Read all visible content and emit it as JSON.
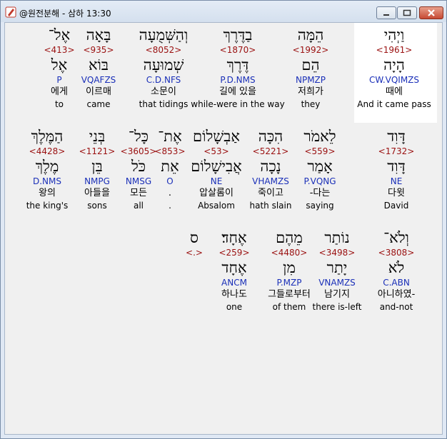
{
  "window": {
    "title": "@원전분해 - 삼하 13:30",
    "icon": "app-icon",
    "controls": [
      "minimize",
      "maximize",
      "close"
    ]
  },
  "rows": [
    [
      {
        "heb": "וַיְהִי",
        "num": "<1961>",
        "lemma": "הָיָה",
        "parse": "CW.VQIMZS",
        "kor": "때에",
        "eng": "And it came pass"
      },
      {
        "heb": "הֵמָּה",
        "num": "<1992>",
        "lemma": "הֵם",
        "parse": "NPMZP",
        "kor": "저희가",
        "eng": "they"
      },
      {
        "heb": "בַדֶּרֶךְ",
        "num": "<1870>",
        "lemma": "דֶּרֶךְ",
        "parse": "P.D.NMS",
        "kor": "길에 있을",
        "eng": "while-were in the way"
      },
      {
        "heb": "וְהַשְּׁמֻעָה",
        "num": "<8052>",
        "lemma": "שְׁמוּעָה",
        "parse": "C.D.NFS",
        "kor": "소문이",
        "eng": "that tidings"
      },
      {
        "heb": "בָּאָה",
        "num": "<935>",
        "lemma": "בּוֹא",
        "parse": "VQAFZS",
        "kor": "이르매",
        "eng": "came"
      },
      {
        "heb": "אֶל־",
        "num": "<413>",
        "lemma": "אֶל",
        "parse": "P",
        "kor": "에게",
        "eng": "to"
      }
    ],
    [
      {
        "heb": "דָּוִד",
        "num": "<1732>",
        "lemma": "דָּוִד",
        "parse": "NE",
        "kor": "다윗",
        "eng": "David"
      },
      {
        "heb": "לֵאמֹר",
        "num": "<559>",
        "lemma": "אָמַר",
        "parse": "P.VQNG",
        "kor": "-다는",
        "eng": "saying"
      },
      {
        "heb": "הִכָּה",
        "num": "<5221>",
        "lemma": "נָכָה",
        "parse": "VHAMZS",
        "kor": "죽이고",
        "eng": "hath slain"
      },
      {
        "heb": "אַבְשָׁלוֹם",
        "num": "<53>",
        "lemma": "אֲבִישָׁלוֹם",
        "parse": "NE",
        "kor": "압살롬이",
        "eng": "Absalom"
      },
      {
        "heb": "אֶת־",
        "num": "<853>",
        "lemma": "אֵת",
        "parse": "O",
        "kor": ".",
        "eng": "."
      },
      {
        "heb": "כָּל־",
        "num": "<3605>",
        "lemma": "כֹּל",
        "parse": "NMSG",
        "kor": "모든",
        "eng": "all"
      },
      {
        "heb": "בְּנֵי",
        "num": "<1121>",
        "lemma": "בֵּן",
        "parse": "NMPG",
        "kor": "아들을",
        "eng": "sons"
      },
      {
        "heb": "הַמֶּלֶךְ",
        "num": "<4428>",
        "lemma": "מֶלֶךְ",
        "parse": "D.NMS",
        "kor": "왕의",
        "eng": "the king's"
      }
    ],
    [
      {
        "heb": "וְלֹא־",
        "num": "<3808>",
        "lemma": "לֹא",
        "parse": "C.ABN",
        "kor": "아니하였-",
        "eng": "and-not"
      },
      {
        "heb": "נוֹתַר",
        "num": "<3498>",
        "lemma": "יָתַר",
        "parse": "VNAMZS",
        "kor": "남기지",
        "eng": "there is-left"
      },
      {
        "heb": "מֵהֶם",
        "num": "<4480>",
        "lemma": "מִן",
        "parse": "P.MZP",
        "kor": "그들로부터",
        "eng": "of them"
      },
      {
        "heb": "אֶחָד׃",
        "num": "<259>",
        "lemma": "אֶחָד",
        "parse": "ANCM",
        "kor": "하나도",
        "eng": "one"
      },
      {
        "heb": "ס",
        "num": "<.>",
        "lemma": "",
        "parse": "",
        "kor": "",
        "eng": ""
      }
    ]
  ]
}
